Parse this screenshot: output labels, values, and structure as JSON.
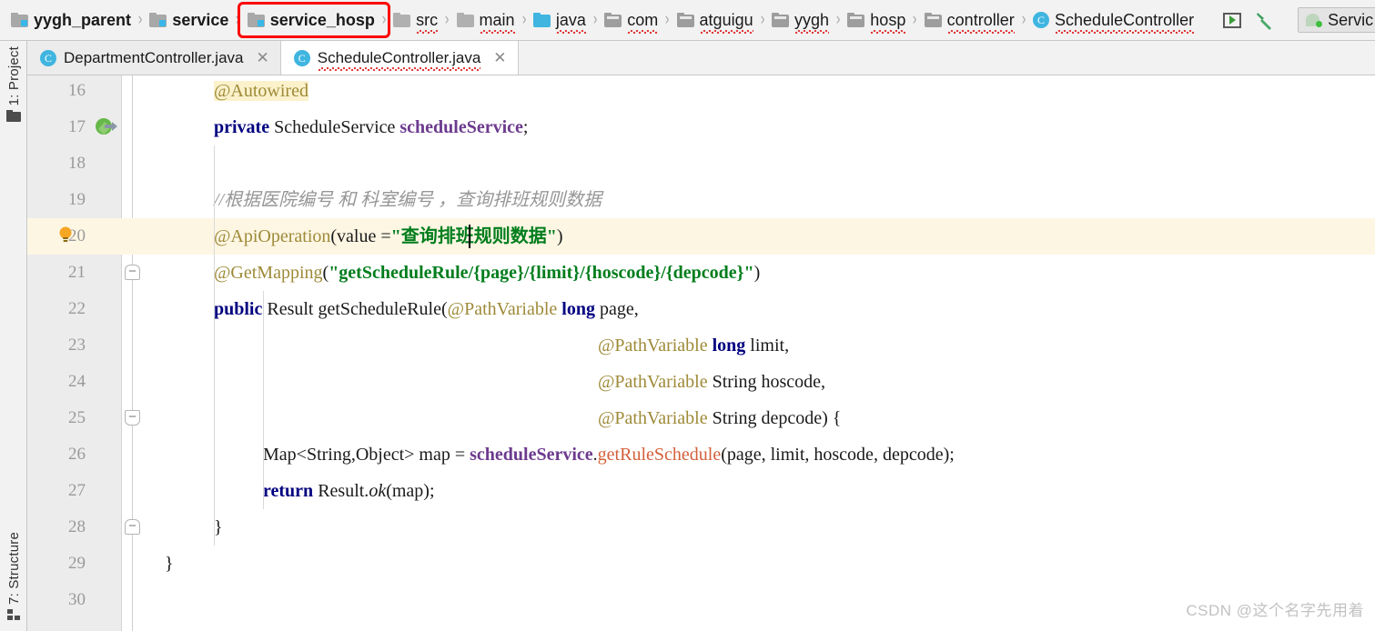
{
  "breadcrumb": {
    "items": [
      {
        "label": "yygh_parent",
        "icon": "module-icon",
        "bold": true,
        "squiggle": false,
        "highlighted": false
      },
      {
        "label": "service",
        "icon": "module-icon",
        "bold": true,
        "squiggle": false,
        "highlighted": false
      },
      {
        "label": "service_hosp",
        "icon": "module-icon",
        "bold": true,
        "squiggle": false,
        "highlighted": true
      },
      {
        "label": "src",
        "icon": "folder-icon",
        "bold": false,
        "squiggle": true,
        "highlighted": false
      },
      {
        "label": "main",
        "icon": "folder-icon",
        "bold": false,
        "squiggle": true,
        "highlighted": false
      },
      {
        "label": "java",
        "icon": "folder-blue-icon",
        "bold": false,
        "squiggle": true,
        "highlighted": false
      },
      {
        "label": "com",
        "icon": "folder-dark-icon",
        "bold": false,
        "squiggle": true,
        "highlighted": false
      },
      {
        "label": "atguigu",
        "icon": "folder-dark-icon",
        "bold": false,
        "squiggle": true,
        "highlighted": false
      },
      {
        "label": "yygh",
        "icon": "folder-dark-icon",
        "bold": false,
        "squiggle": true,
        "highlighted": false
      },
      {
        "label": "hosp",
        "icon": "folder-dark-icon",
        "bold": false,
        "squiggle": true,
        "highlighted": false
      },
      {
        "label": "controller",
        "icon": "folder-dark-icon",
        "bold": false,
        "squiggle": true,
        "highlighted": false
      },
      {
        "label": "ScheduleController",
        "icon": "class-icon",
        "bold": false,
        "squiggle": true,
        "highlighted": false
      }
    ],
    "separator": "›",
    "class_icon_letter": "C",
    "highlight_color": "#ff0000"
  },
  "toolbar": {
    "run_icon": "run-icon",
    "build_icon": "hammer-icon",
    "run_config_label": "Servic"
  },
  "tool_strip": {
    "project": "1: Project",
    "structure": "7: Structure"
  },
  "tabs": [
    {
      "label": "DepartmentController.java",
      "active": false,
      "icon_letter": "C",
      "squiggle": false,
      "close": "✕"
    },
    {
      "label": "ScheduleController.java",
      "active": true,
      "icon_letter": "C",
      "squiggle": true,
      "close": "✕"
    }
  ],
  "editor": {
    "caret_line": 20,
    "current_line_bg": "#fdf6e3",
    "annotation_highlight_bg": "#fbf2cc",
    "lines": [
      {
        "num": 16,
        "indent": 72,
        "tokens": [
          {
            "t": "@Autowired",
            "c": "annoHL"
          }
        ]
      },
      {
        "num": 17,
        "indent": 72,
        "gutter_icon": "override-icon",
        "tokens": [
          {
            "t": "private",
            "c": "kw"
          },
          {
            "t": " ",
            "c": "plain"
          },
          {
            "t": "ScheduleService",
            "c": "plain"
          },
          {
            "t": " ",
            "c": "plain"
          },
          {
            "t": "scheduleService",
            "c": "fld"
          },
          {
            "t": ";",
            "c": "plain"
          }
        ]
      },
      {
        "num": 18,
        "indent": 72,
        "tokens": []
      },
      {
        "num": 19,
        "indent": 72,
        "tokens": [
          {
            "t": "//根据医院编号 和 科室编号 ，查询排班规则数据",
            "c": "cmt"
          }
        ]
      },
      {
        "num": 20,
        "indent": 72,
        "current": true,
        "gutter_icon": "bulb-icon",
        "fold": "down",
        "tokens": [
          {
            "t": "@ApiOperation",
            "c": "anno"
          },
          {
            "t": "(value =",
            "c": "plain"
          },
          {
            "t": "\"查询排班规则数据\"",
            "c": "str"
          },
          {
            "t": ")",
            "c": "plain"
          }
        ]
      },
      {
        "num": 21,
        "indent": 72,
        "fold": "up",
        "tokens": [
          {
            "t": "@GetMapping",
            "c": "anno"
          },
          {
            "t": "(",
            "c": "plain"
          },
          {
            "t": "\"getScheduleRule/{page}/{limit}/{hoscode}/{depcode}\"",
            "c": "str"
          },
          {
            "t": ")",
            "c": "plain"
          }
        ]
      },
      {
        "num": 22,
        "indent": 72,
        "tokens": [
          {
            "t": "public",
            "c": "kw"
          },
          {
            "t": " Result getScheduleRule(",
            "c": "plain"
          },
          {
            "t": "@PathVariable",
            "c": "anno"
          },
          {
            "t": " ",
            "c": "plain"
          },
          {
            "t": "long",
            "c": "kw"
          },
          {
            "t": " page,",
            "c": "plain"
          }
        ]
      },
      {
        "num": 23,
        "indent": 494,
        "tokens": [
          {
            "t": "@PathVariable",
            "c": "anno"
          },
          {
            "t": " ",
            "c": "plain"
          },
          {
            "t": "long",
            "c": "kw"
          },
          {
            "t": " limit,",
            "c": "plain"
          }
        ]
      },
      {
        "num": 24,
        "indent": 494,
        "tokens": [
          {
            "t": "@PathVariable",
            "c": "anno"
          },
          {
            "t": " String hoscode,",
            "c": "plain"
          }
        ]
      },
      {
        "num": 25,
        "indent": 494,
        "fold": "down",
        "tokens": [
          {
            "t": "@PathVariable",
            "c": "anno"
          },
          {
            "t": " String depcode) {",
            "c": "plain"
          }
        ]
      },
      {
        "num": 26,
        "indent": 126,
        "tokens": [
          {
            "t": "Map<String,Object> map = ",
            "c": "plain"
          },
          {
            "t": "scheduleService",
            "c": "fld"
          },
          {
            "t": ".",
            "c": "plain"
          },
          {
            "t": "getRuleSchedule",
            "c": "mth"
          },
          {
            "t": "(page, limit, hoscode, depcode);",
            "c": "plain"
          }
        ]
      },
      {
        "num": 27,
        "indent": 126,
        "tokens": [
          {
            "t": "return",
            "c": "kw"
          },
          {
            "t": " Result.",
            "c": "plain"
          },
          {
            "t": "ok",
            "c": "sm"
          },
          {
            "t": "(map);",
            "c": "plain"
          }
        ]
      },
      {
        "num": 28,
        "indent": 72,
        "fold": "up",
        "tokens": [
          {
            "t": "}",
            "c": "plain"
          }
        ]
      },
      {
        "num": 29,
        "indent": 18,
        "tokens": [
          {
            "t": "}",
            "c": "plain"
          }
        ]
      },
      {
        "num": 30,
        "indent": 18,
        "tokens": []
      }
    ]
  },
  "watermark": "CSDN @这个名字先用着"
}
